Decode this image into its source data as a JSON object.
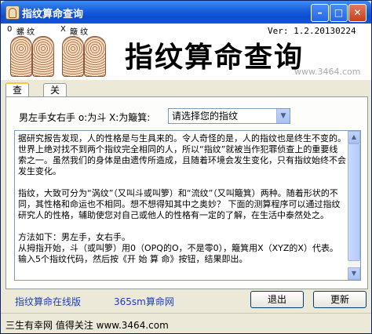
{
  "window": {
    "title": "指纹算命查询"
  },
  "header": {
    "left_label": "0",
    "right_label": "X",
    "left_finger_text": "螺  纹",
    "right_finger_text": "簸  纹",
    "big_title": "指纹算命查询",
    "version": "Ver: 1.2.20130224",
    "website": "www.3464.com"
  },
  "tabs": [
    {
      "label": "查询"
    },
    {
      "label": "关于"
    }
  ],
  "query": {
    "select_label": "男左手女右手  o:为斗  X:为簸箕:",
    "select_value": "请选择您的指纹",
    "paragraphs": [
      "据研究报告发现，人的性格是与生具来的。令人奇怪的是，人的指纹也是终生不变的。世界上绝对找不到两个指纹完全相同的人，所以“指纹”就被当作犯罪侦查上的重要线索之一。虽然我们的身体是由遗传所造成，且随着环境会发生变化，只有指纹始终不会发生变化。",
      "指纹，大致可分为“涡纹”（又叫斗或叫箩）和“流纹”（又叫簸箕）两种。随着形状的不同，其性格和命运也不相同。想不想得知其中之奥妙？ 下面的测算程序可以通过指纹研究人的性格，辅助使您对自己或他人的性格有一定的了解，在生活中泰然处之。",
      "方法如下：男左手，女右手。",
      "从拇指开始，斗（或叫箩）用0（OPQ的O，不是零0），簸箕用X（XYZ的X）代表。输入5个指纹代码，然后按《开 始 算 命》按钮，结果即出。"
    ]
  },
  "footer": {
    "link_online": "指纹算命在线版",
    "link_365": "365sm算命网",
    "exit_button": "退出",
    "update_button": "更新"
  },
  "status": {
    "text": "三生有幸网  值得关注  www.3464.com"
  }
}
